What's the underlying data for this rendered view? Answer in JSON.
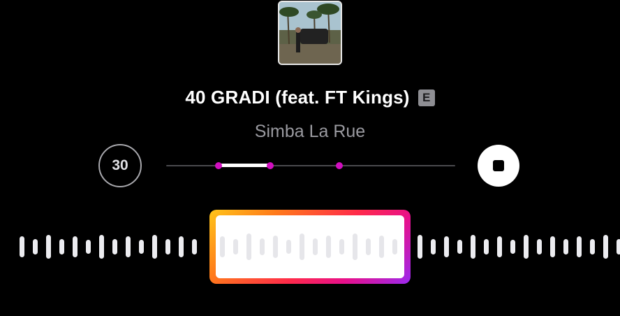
{
  "track": {
    "title": "40 GRADI (feat. FT Kings)",
    "explicit_badge": "E",
    "artist": "Simba La Rue",
    "cover_icon": "album-cover-palm-trees"
  },
  "controls": {
    "skip_label": "30",
    "stop_icon": "stop-icon"
  },
  "scrubber": {
    "selection_start": 0.18,
    "selection_end": 0.36,
    "playhead": 0.6
  },
  "colors": {
    "background": "#000000",
    "marker": "#d10fbf",
    "frame_gradient": [
      "#ffc61a",
      "#ff7a1a",
      "#ff2a4a",
      "#e8108a",
      "#9a2af0"
    ]
  }
}
